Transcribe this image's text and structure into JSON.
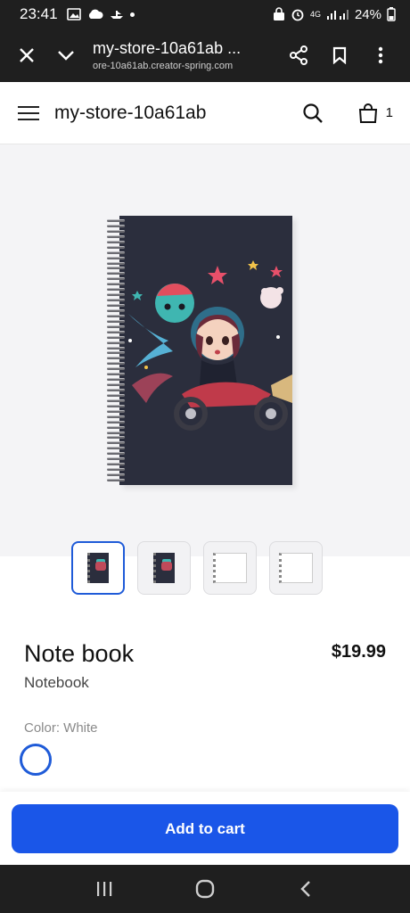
{
  "status_bar": {
    "time": "23:41",
    "network": "4G",
    "battery": "24%"
  },
  "browser": {
    "page_title": "my-store-10a61ab ...",
    "url": "ore-10a61ab.creator-spring.com"
  },
  "store": {
    "name": "my-store-10a61ab",
    "cart_count": "1"
  },
  "product": {
    "title": "Note book",
    "type": "Notebook",
    "price": "$19.99",
    "color_label": "Color: White",
    "thumbnails": [
      "front-cover",
      "front-cover-alt",
      "inside-page",
      "inside-page-alt"
    ]
  },
  "cart": {
    "add_label": "Add to cart"
  },
  "colors": {
    "accent": "#1a56e8",
    "selected_border": "#1f5bd8",
    "bar_dark": "#1f1f1f",
    "hero_bg": "#f4f4f6",
    "cover": "#2b2e3d"
  }
}
